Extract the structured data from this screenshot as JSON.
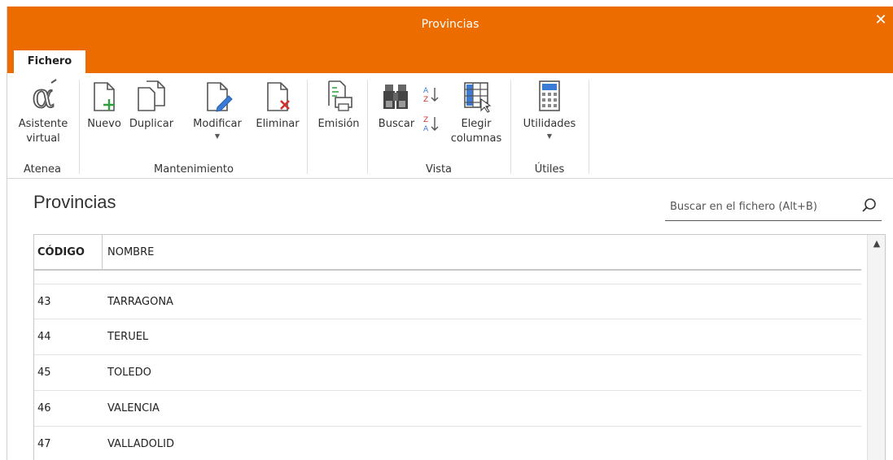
{
  "window": {
    "title": "Provincias",
    "close_glyph": "✕"
  },
  "tabs": [
    {
      "label": "Fichero",
      "active": true
    }
  ],
  "ribbon": {
    "groups": [
      {
        "label": "Atenea",
        "buttons": [
          {
            "label": "Asistente virtual",
            "icon": "alpha-assistant-icon"
          }
        ]
      },
      {
        "label": "Mantenimiento",
        "buttons": [
          {
            "label": "Nuevo",
            "icon": "new-document-icon"
          },
          {
            "label": "Duplicar",
            "icon": "duplicate-icon"
          },
          {
            "label": "Modificar",
            "icon": "edit-document-icon",
            "has_dropdown": true
          },
          {
            "label": "Eliminar",
            "icon": "delete-document-icon"
          },
          {
            "label": "Emisión",
            "icon": "print-icon"
          }
        ]
      },
      {
        "label": "Vista",
        "buttons": [
          {
            "label": "Buscar",
            "icon": "binoculars-icon"
          },
          {
            "label": "sort-ascending",
            "icon": "sort-az-icon"
          },
          {
            "label": "sort-descending",
            "icon": "sort-za-icon"
          },
          {
            "label": "Elegir columnas",
            "icon": "choose-columns-icon"
          }
        ]
      },
      {
        "label": "Útiles",
        "buttons": [
          {
            "label": "Utilidades",
            "icon": "calculator-icon",
            "has_dropdown": true
          }
        ]
      }
    ]
  },
  "page": {
    "title": "Provincias"
  },
  "search": {
    "placeholder": "Buscar en el fichero (Alt+B)",
    "icon": "search-icon"
  },
  "table": {
    "columns": [
      {
        "label": "CÓDIGO"
      },
      {
        "label": "NOMBRE"
      }
    ],
    "rows": [
      {
        "code": "43",
        "name": "TARRAGONA"
      },
      {
        "code": "44",
        "name": "TERUEL"
      },
      {
        "code": "45",
        "name": "TOLEDO"
      },
      {
        "code": "46",
        "name": "VALENCIA"
      },
      {
        "code": "47",
        "name": "VALLADOLID"
      }
    ]
  },
  "colors": {
    "accent": "#ec6c00",
    "icon_green": "#2e9e3e",
    "icon_red": "#d32f2f",
    "icon_blue": "#3a7bd5"
  }
}
